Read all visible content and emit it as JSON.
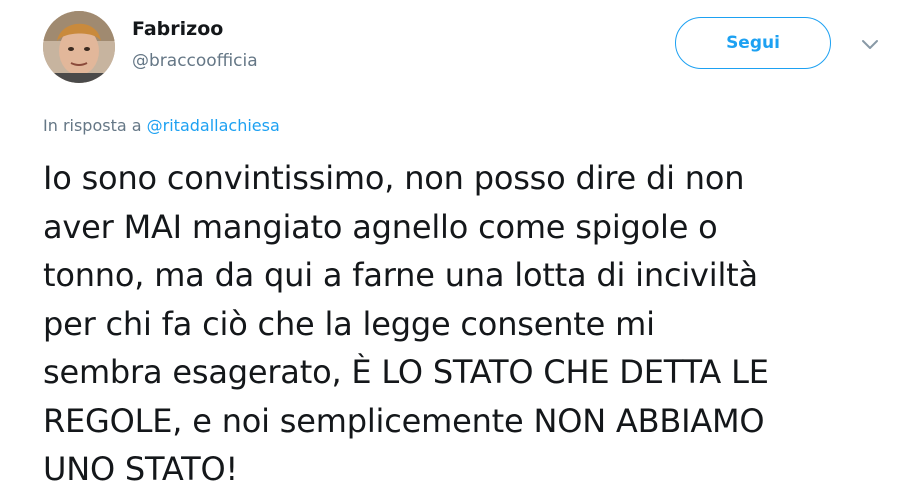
{
  "user": {
    "display_name": "Fabrizoo",
    "handle": "@braccoofficia"
  },
  "follow_button_label": "Segui",
  "reply": {
    "prefix": "In risposta a",
    "mention": "@ritadallachiesa"
  },
  "tweet": {
    "lines": [
      "Io sono convintissimo, non posso dire di non",
      "aver MAI mangiato agnello come spigole o",
      "tonno, ma da qui a farne una lotta di inciviltà",
      "per chi fa ciò che la legge consente mi",
      "sembra esagerato, È LO STATO CHE DETTA LE",
      "REGOLE, e noi semplicemente NON ABBIAMO",
      "UNO STATO!"
    ]
  },
  "icons": {
    "avatar": "user-avatar-photo",
    "caret": "chevron-down-icon"
  },
  "colors": {
    "accent": "#1da1f2",
    "text_primary": "#14171a",
    "text_secondary": "#657786",
    "caret": "#8899a6"
  }
}
